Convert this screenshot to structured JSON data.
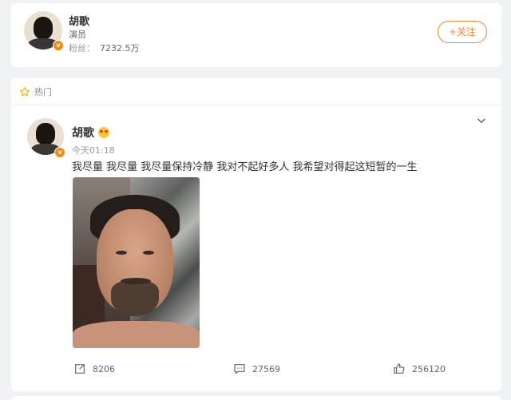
{
  "profile": {
    "name": "胡歌",
    "role": "演员",
    "fans_label": "粉丝：",
    "fans_count": "7232.5万",
    "follow_label": "+关注",
    "verified_badge": "v"
  },
  "post": {
    "section_label": "热门",
    "author": "胡歌",
    "time": "今天01:18",
    "text": "我尽量 我尽量 我尽量保持冷静 我对不起好多人 我希望对得起这短暂的一生",
    "verified_badge": "v",
    "actions": {
      "repost_count": "8206",
      "comment_count": "27569",
      "like_count": "256120"
    }
  },
  "icons": {
    "hot": "star-icon",
    "menu": "chevron-down-icon",
    "repost": "repost-icon",
    "comment": "comment-icon",
    "like": "thumbs-up-icon"
  },
  "colors": {
    "accent": "#f18634",
    "verified": "#f28a17",
    "hot_icon": "#f5b400"
  }
}
